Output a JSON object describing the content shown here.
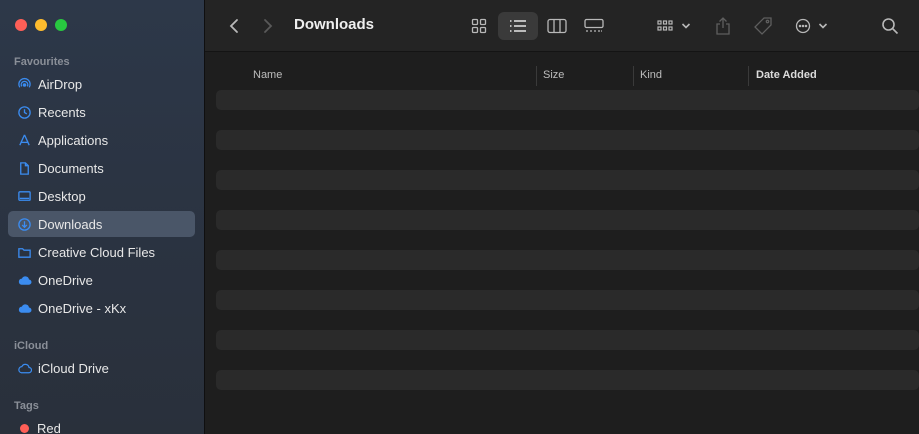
{
  "sidebar": {
    "favourites_title": "Favourites",
    "favourites": [
      {
        "label": "AirDrop",
        "icon": "airdrop-icon"
      },
      {
        "label": "Recents",
        "icon": "clock-icon"
      },
      {
        "label": "Applications",
        "icon": "applications-icon"
      },
      {
        "label": "Documents",
        "icon": "document-icon"
      },
      {
        "label": "Desktop",
        "icon": "desktop-icon"
      },
      {
        "label": "Downloads",
        "icon": "download-icon",
        "active": true
      },
      {
        "label": "Creative Cloud Files",
        "icon": "folder-icon"
      },
      {
        "label": "OneDrive",
        "icon": "cloud-filled-icon"
      },
      {
        "label": "OneDrive - xKx",
        "icon": "cloud-filled-icon"
      }
    ],
    "icloud_title": "iCloud",
    "icloud": [
      {
        "label": "iCloud Drive",
        "icon": "cloud-icon"
      }
    ],
    "tags_title": "Tags",
    "tags": [
      {
        "label": "Red",
        "color": "#ff5f57"
      }
    ]
  },
  "toolbar": {
    "title": "Downloads"
  },
  "columns": {
    "name": "Name",
    "size": "Size",
    "kind": "Kind",
    "date_added": "Date Added"
  },
  "colors": {
    "accent": "#3b8cf0",
    "sidebar_active": "#4a5668",
    "row_placeholder": "#2a2a2a"
  }
}
